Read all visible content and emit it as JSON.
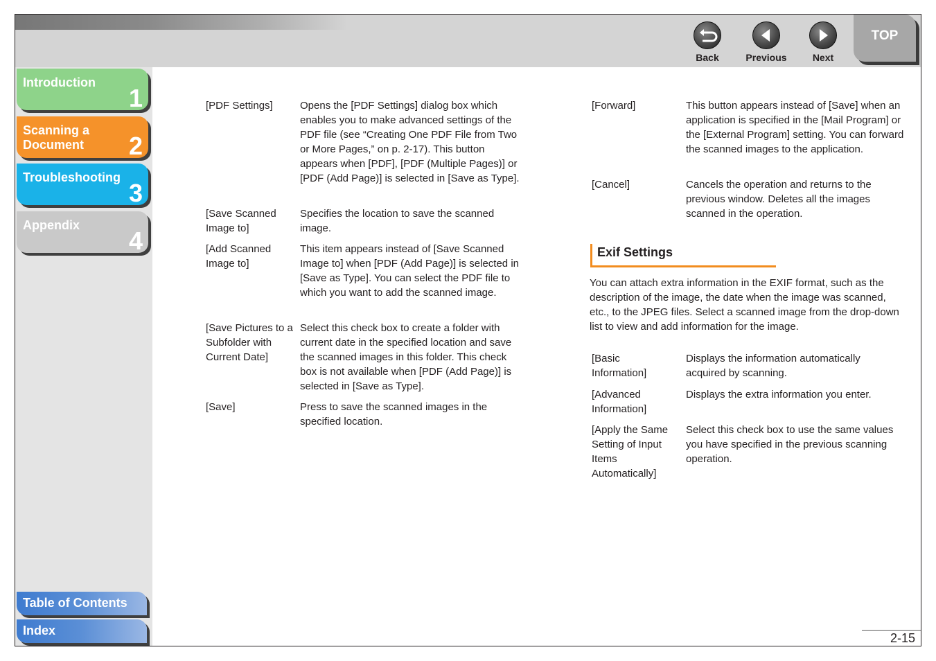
{
  "header": {
    "nav": [
      {
        "label": "Back",
        "icon": "back-arrow-icon"
      },
      {
        "label": "Previous",
        "icon": "triangle-left-icon"
      },
      {
        "label": "Next",
        "icon": "triangle-right-icon"
      }
    ],
    "top_label": "TOP"
  },
  "sidebar": {
    "chapters": [
      {
        "label": "Introduction",
        "number": "1",
        "color": "#8ed38a"
      },
      {
        "label": "Scanning a Document",
        "number": "2",
        "color": "#f5922a"
      },
      {
        "label": "Troubleshooting",
        "number": "3",
        "color": "#1ab2e8"
      },
      {
        "label": "Appendix",
        "number": "4",
        "color": "#c9c9c9"
      }
    ],
    "toc_label": "Table of Contents",
    "index_label": "Index"
  },
  "left_column": [
    {
      "term": "[PDF Settings]",
      "desc": "Opens the [PDF Settings] dialog box which enables you to make advanced settings of the PDF file (see “Creating One PDF File from Two or More Pages,” on p. 2-17). This button appears when [PDF], [PDF (Multiple Pages)] or [PDF (Add Page)] is selected in [Save as Type]."
    },
    {
      "term": "[Save Scanned Image to]",
      "desc": "Specifies the location to save the scanned image."
    },
    {
      "term": "[Add Scanned Image to]",
      "desc": "This item appears instead of [Save Scanned Image to] when [PDF (Add Page)] is selected in [Save as Type]. You can select the PDF file to which you want to add the scanned image."
    },
    {
      "term": "[Save Pictures to a Subfolder with Current Date]",
      "desc": "Select this check box to create a folder with current date in the specified location and save the scanned images in this folder. This check box is not available when [PDF (Add Page)] is selected in [Save as Type]."
    },
    {
      "term": "[Save]",
      "desc": "Press to save the scanned images in the specified location."
    }
  ],
  "right_column": [
    {
      "term": "[Forward]",
      "desc": "This button appears instead of [Save] when an application is specified in the [Mail Program] or the [External Program] setting. You can forward the scanned images to the application."
    },
    {
      "term": "[Cancel]",
      "desc": "Cancels the operation and returns to the previous window. Deletes all the images scanned in the operation."
    }
  ],
  "exif": {
    "heading": "Exif Settings",
    "intro": "You can attach extra information in the EXIF format, such as the description of the image, the date when the image was scanned, etc., to the JPEG files. Select a scanned image from the drop-down list to view and add information for the image.",
    "items": [
      {
        "term": "[Basic Information]",
        "desc": "Displays the information automatically acquired by scanning."
      },
      {
        "term": "[Advanced Information]",
        "desc": "Displays the extra information you enter."
      },
      {
        "term": "[Apply the Same Setting of Input Items Automatically]",
        "desc": "Select this check box to use the same values you have specified in the previous scanning operation."
      }
    ]
  },
  "page_number": "2-15"
}
